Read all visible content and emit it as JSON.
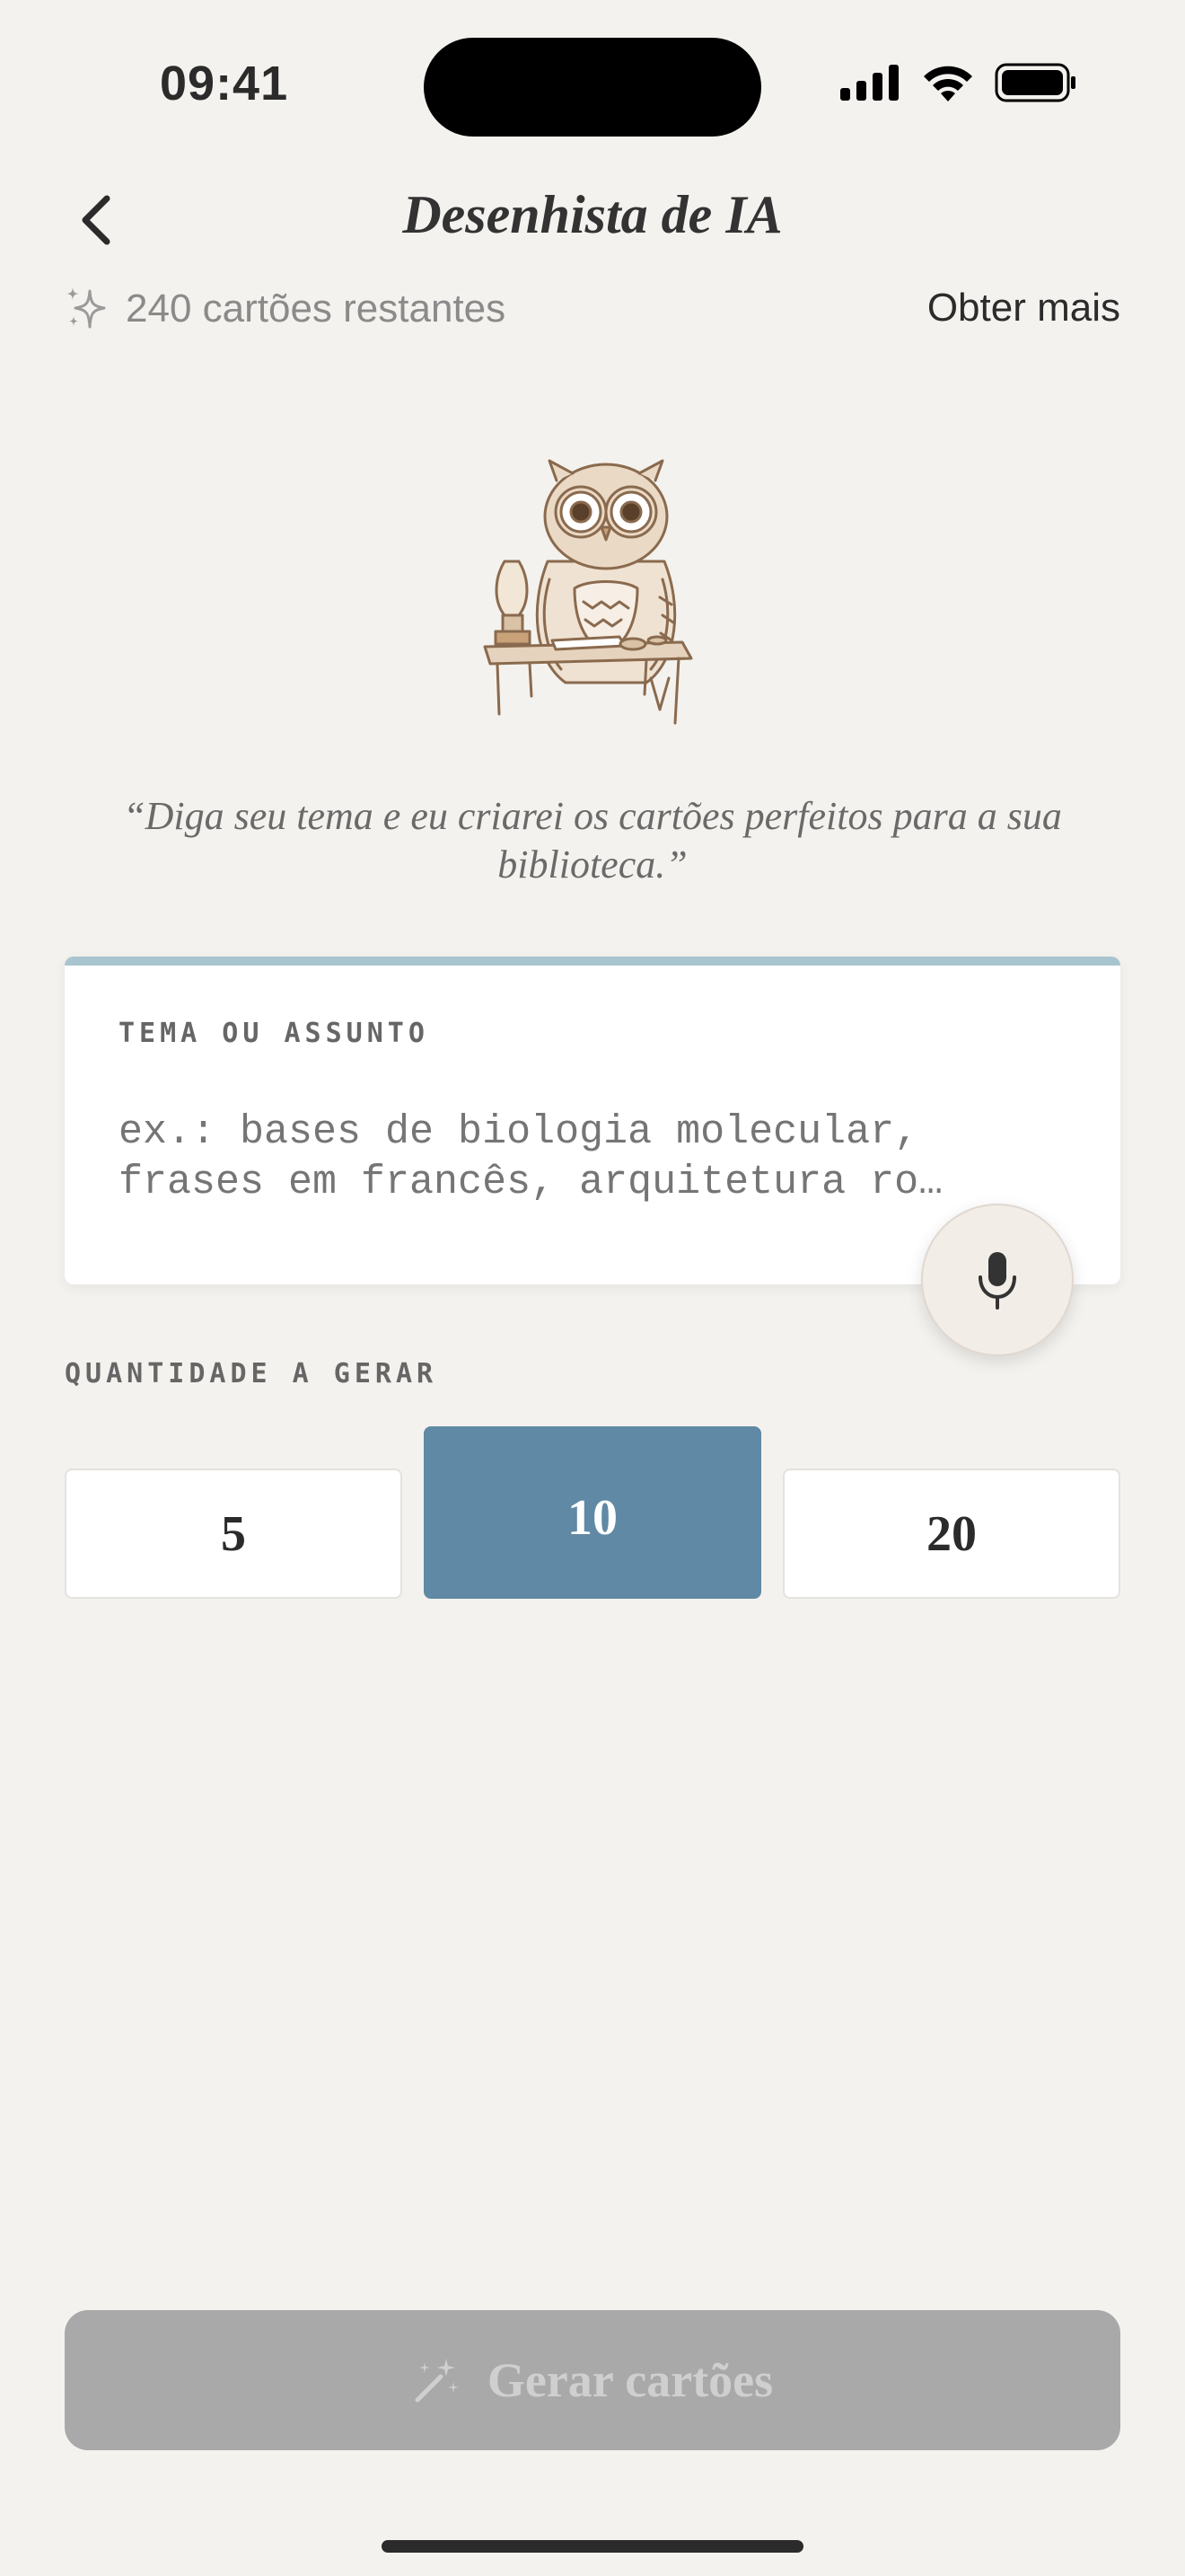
{
  "status_bar": {
    "time": "09:41",
    "icons": [
      "signal-icon",
      "wifi-icon",
      "battery-icon"
    ]
  },
  "header": {
    "title": "Desenhista de IA",
    "back_icon": "chevron-left-icon"
  },
  "credits": {
    "text": "240 cartões restantes",
    "icon": "sparkle-icon",
    "get_more": "Obter mais"
  },
  "quote": "“Diga seu tema e eu criarei os cartões perfeitos para a sua biblioteca.”",
  "topic": {
    "label": "TEMA OU ASSUNTO",
    "placeholder": "ex.: bases de biologia molecular, frases em francês, arquitetura ro…",
    "value": ""
  },
  "quantity": {
    "label": "QUANTIDADE A GERAR",
    "options": [
      "5",
      "10",
      "20"
    ],
    "selected": "10"
  },
  "generate": {
    "label": "Gerar cartões",
    "icon": "magic-wand-icon",
    "enabled": false
  },
  "colors": {
    "accent": "#5f89a4",
    "card_top_border": "#a8c5cf",
    "background": "#f4f2ee",
    "disabled_button": "#a9a9a9"
  }
}
